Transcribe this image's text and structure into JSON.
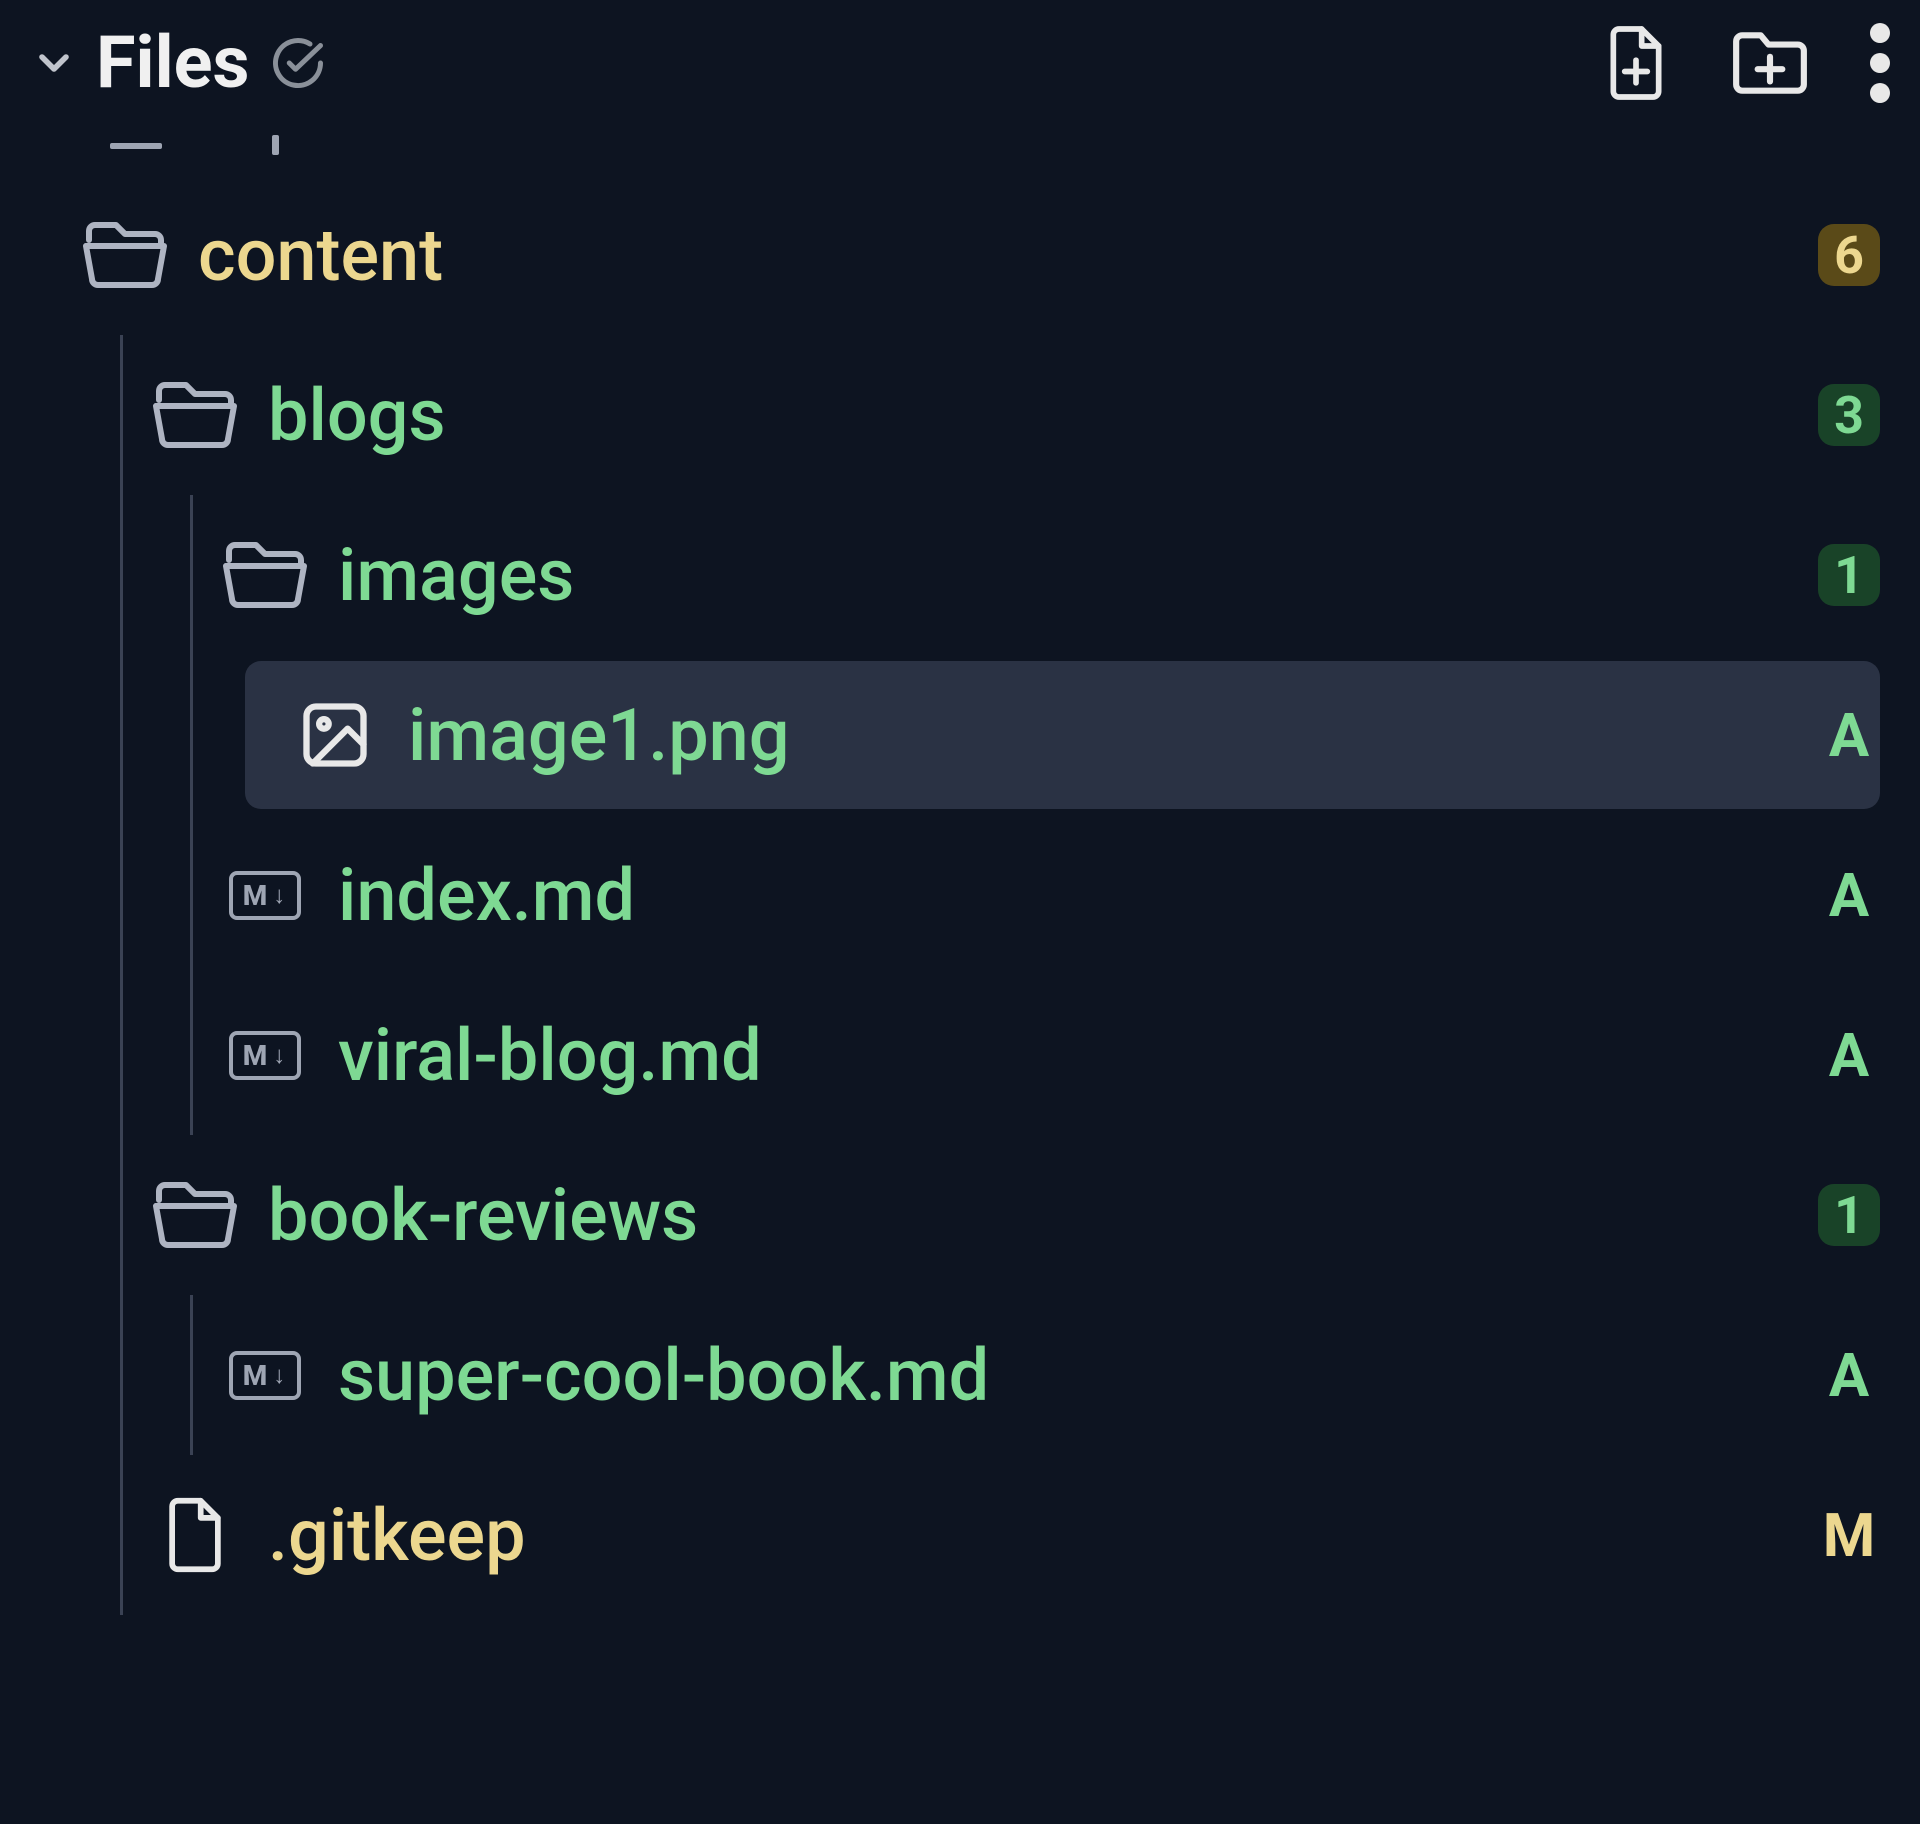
{
  "header": {
    "title": "Files"
  },
  "tree": {
    "content": {
      "label": "content",
      "badge": "6",
      "badge_style": "yellow",
      "label_style": "yellow"
    },
    "blogs": {
      "label": "blogs",
      "badge": "3",
      "badge_style": "green",
      "label_style": "green"
    },
    "images": {
      "label": "images",
      "badge": "1",
      "badge_style": "green",
      "label_style": "green"
    },
    "image1": {
      "label": "image1.png",
      "status": "A",
      "label_style": "green"
    },
    "index_md": {
      "label": "index.md",
      "status": "A",
      "label_style": "green"
    },
    "viral_blog": {
      "label": "viral-blog.md",
      "status": "A",
      "label_style": "green"
    },
    "book_reviews": {
      "label": "book-reviews",
      "badge": "1",
      "badge_style": "green",
      "label_style": "green"
    },
    "super_cool_book": {
      "label": "super-cool-book.md",
      "status": "A",
      "label_style": "green"
    },
    "gitkeep": {
      "label": ".gitkeep",
      "status": "M",
      "label_style": "yellow"
    }
  }
}
